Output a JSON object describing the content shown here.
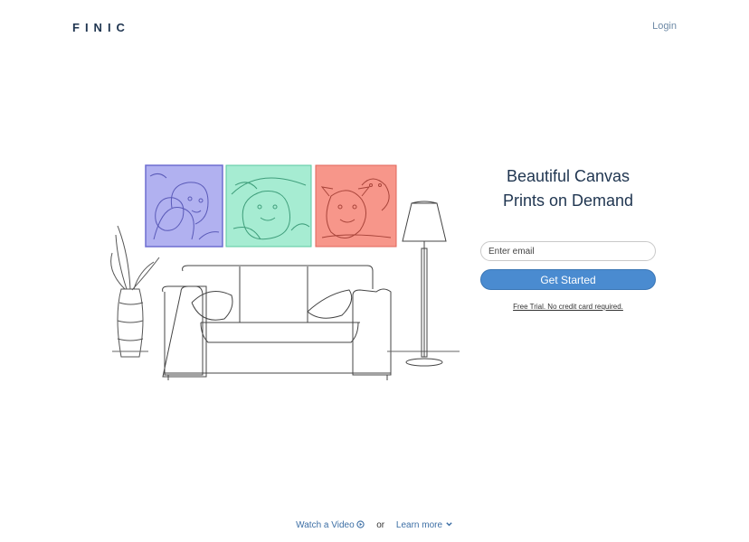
{
  "header": {
    "logo": "FINIC",
    "login_label": "Login"
  },
  "hero": {
    "title_line1": "Beautiful Canvas",
    "title_line2": "Prints on Demand",
    "email_placeholder": "Enter email",
    "cta_label": "Get Started",
    "fine_print": "Free Trial. No credit card required."
  },
  "footer": {
    "watch_video_label": "Watch a Video",
    "separator": "or",
    "learn_more_label": "Learn more"
  },
  "colors": {
    "brand": "#1f3550",
    "accent": "#4a8bd0",
    "canvas_purple": "#b1b1f0",
    "canvas_mint": "#a6ecd2",
    "canvas_salmon": "#f7968a"
  },
  "icons": {
    "watch_video": "play-circle-icon",
    "learn_more": "chevron-down-icon"
  }
}
